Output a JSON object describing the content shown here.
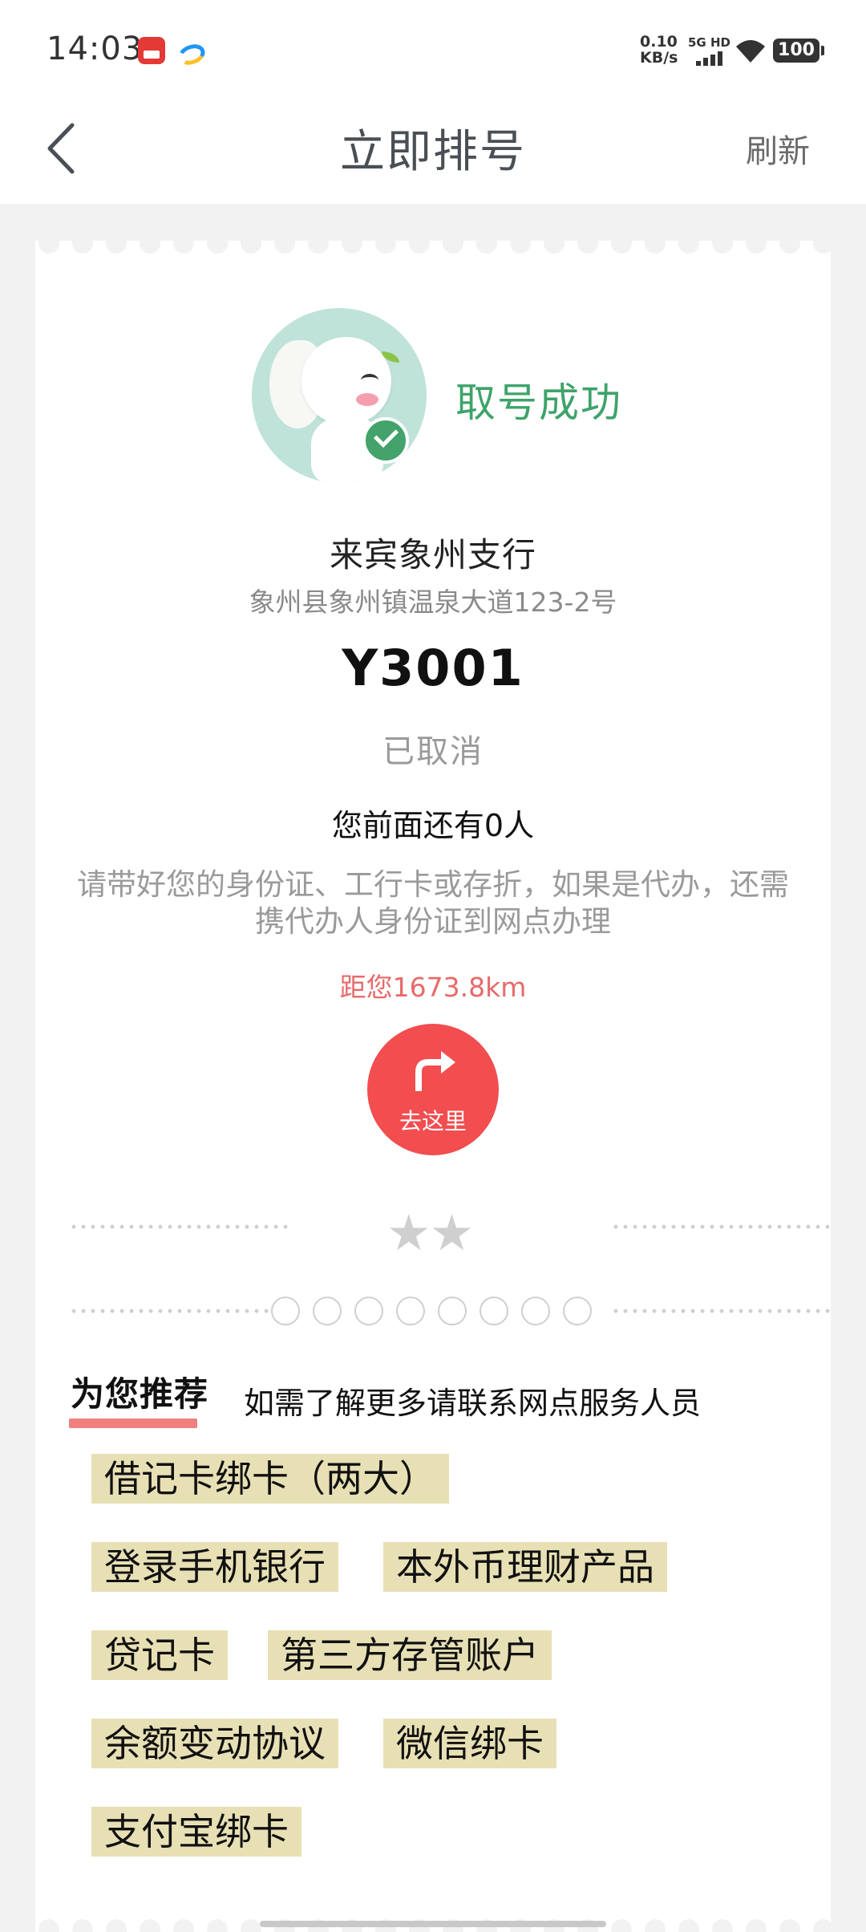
{
  "status_bar": {
    "time": "14:03",
    "net_speed_value": "0.10",
    "net_speed_unit": "KB/s",
    "signal_label": "5G HD",
    "battery": "100"
  },
  "nav": {
    "title": "立即排号",
    "refresh": "刷新"
  },
  "ticket": {
    "success_text": "取号成功",
    "branch_name": "来宾象州支行",
    "address": "象州县象州镇温泉大道123-2号",
    "number": "Y3001",
    "status": "已取消",
    "people_ahead": "您前面还有0人",
    "notice": "请带好您的身份证、工行卡或存折，如果是代办，还需携代办人身份证到网点办理",
    "distance": "距您1673.8km",
    "go_label": "去这里",
    "stars": "★★"
  },
  "recommend": {
    "title": "为您推荐",
    "note": "如需了解更多请联系网点服务人员",
    "tags": [
      "借记卡绑卡（两大）",
      "登录手机银行",
      "本外币理财产品",
      "贷记卡",
      "第三方存管账户",
      "余额变动协议",
      "微信绑卡",
      "支付宝绑卡"
    ]
  },
  "colors": {
    "success_green": "#3ea36a",
    "go_button_red": "#f24d4f",
    "distance_red": "#e86a6a",
    "tag_bg": "#e8e0b5"
  }
}
